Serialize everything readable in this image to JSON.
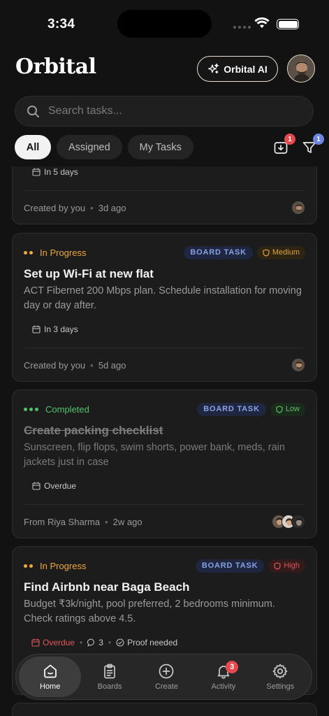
{
  "status_bar": {
    "time": "3:34"
  },
  "header": {
    "app_name": "Orbital",
    "ai_button_label": "Orbital AI"
  },
  "search": {
    "placeholder": "Search tasks..."
  },
  "filters": {
    "tabs": [
      "All",
      "Assigned",
      "My Tasks"
    ],
    "active_tab": "All",
    "inbox_badge": "1",
    "filter_badge": "1"
  },
  "tasks": [
    {
      "due": "In 5 days",
      "creator": "Created by you",
      "time_ago": "3d ago"
    },
    {
      "status": "In Progress",
      "board_tag": "BOARD TASK",
      "priority": "Medium",
      "title": "Set up Wi-Fi at new flat",
      "description": "ACT Fibernet 200 Mbps plan. Schedule installation for moving day or day after.",
      "due": "In 3 days",
      "creator": "Created by you",
      "time_ago": "5d ago"
    },
    {
      "status": "Completed",
      "board_tag": "BOARD TASK",
      "priority": "Low",
      "title": "Create packing checklist",
      "description": "Sunscreen, flip flops, swim shorts, power bank, meds, rain jackets just in case",
      "due": "Overdue",
      "creator": "From Riya Sharma",
      "time_ago": "2w ago"
    },
    {
      "status": "In Progress",
      "board_tag": "BOARD TASK",
      "priority": "High",
      "title": "Find Airbnb near Baga Beach",
      "description": "Budget ₹3k/night, pool preferred, 2 bedrooms minimum. Check ratings above 4.5.",
      "due": "Overdue",
      "comments": "3",
      "proof": "Proof needed"
    }
  ],
  "nav": {
    "items": [
      "Home",
      "Boards",
      "Create",
      "Activity",
      "Settings"
    ],
    "active": "Home",
    "activity_badge": "3"
  },
  "colors": {
    "in_progress": "#f0a93a",
    "completed": "#4cc46a",
    "medium": "#e0a43a",
    "low": "#5fbf6a",
    "high": "#e0575a",
    "board_tag": "#8aa0e6"
  }
}
